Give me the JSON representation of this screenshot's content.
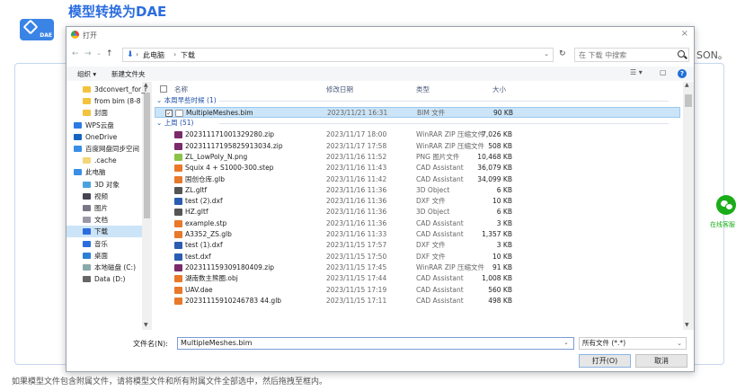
{
  "page": {
    "title": "模型转换为DAE",
    "logo_tag": "DAE",
    "json_suffix": "SON。",
    "footer_text": "如果模型文件包含附属文件，请将模型文件和所有附属文件全部选中，然后拖拽至框内。",
    "wechat_label": "在线客服"
  },
  "dialog": {
    "title": "打开",
    "close_symbol": "×",
    "nav": {
      "back": "←",
      "forward": "→",
      "recent": "⌄",
      "up": "↑"
    },
    "breadcrumb": [
      "此电脑",
      "下载"
    ],
    "breadcrumb_sep": "›",
    "path_dropdown": "⌄",
    "refresh": "↻",
    "search_placeholder": "在 下载 中搜索",
    "toolbar": {
      "organize": "组织 ▾",
      "new_folder": "新建文件夹",
      "view": "☰ ▾",
      "pane": "▢",
      "help": "?"
    },
    "sidebar": [
      {
        "label": "3dconvert_for_r",
        "color": "#f3c33d"
      },
      {
        "label": "from bim  (8-8",
        "color": "#f3c33d"
      },
      {
        "label": "封面",
        "color": "#f3c33d"
      },
      {
        "label": "WPS云盘",
        "color": "#2c7be5"
      },
      {
        "label": "OneDrive",
        "color": "#1565c0"
      },
      {
        "label": "百度网盘同步空间",
        "color": "#3a8ee6"
      },
      {
        "label": ".cache",
        "color": "#f3d57a"
      },
      {
        "label": "此电脑",
        "color": "#3a8ee6"
      },
      {
        "label": "3D 对象",
        "color": "#4aa3df"
      },
      {
        "label": "视频",
        "color": "#445"
      },
      {
        "label": "图片",
        "color": "#778"
      },
      {
        "label": "文档",
        "color": "#99a"
      },
      {
        "label": "下载",
        "color": "#2b6de0"
      },
      {
        "label": "音乐",
        "color": "#2b6de0"
      },
      {
        "label": "桌面",
        "color": "#2b7fd6"
      },
      {
        "label": "本地磁盘 (C:)",
        "color": "#8aa"
      },
      {
        "label": "Data (D:)",
        "color": "#666"
      }
    ],
    "columns": {
      "name": "名称",
      "date": "修改日期",
      "type": "类型",
      "size": "大小"
    },
    "groups": [
      {
        "label": "本周早些时候 (1)",
        "files": [
          {
            "name": "MultipleMeshes.bim",
            "date": "2023/11/21 16:31",
            "type": "BIM 文件",
            "size": "90 KB",
            "icon": "#ffffff",
            "selected": true
          }
        ]
      },
      {
        "label": "上周 (51)",
        "files": [
          {
            "name": "202311171001329280.zip",
            "date": "2023/11/17 18:00",
            "type": "WinRAR ZIP 压缩文件",
            "size": "7,026 KB",
            "icon": "#7b2a6b"
          },
          {
            "name": "202311171958259130​34.zip",
            "date": "2023/11/17 17:58",
            "type": "WinRAR ZIP 压缩文件",
            "size": "508 KB",
            "icon": "#7b2a6b"
          },
          {
            "name": "ZL_LowPoly_N.png",
            "date": "2023/11/16 11:52",
            "type": "PNG 图片文件",
            "size": "10,468 KB",
            "icon": "#8bc34a"
          },
          {
            "name": "Squix 4 + S1000-300.step",
            "date": "2023/11/16 11:43",
            "type": "CAD Assistant",
            "size": "36,079 KB",
            "icon": "#e8782a"
          },
          {
            "name": "国创仓库.glb",
            "date": "2023/11/16 11:42",
            "type": "CAD Assistant",
            "size": "34,099 KB",
            "icon": "#e8782a"
          },
          {
            "name": "ZL.gltf",
            "date": "2023/11/16 11:36",
            "type": "3D Object",
            "size": "6 KB",
            "icon": "#555555"
          },
          {
            "name": "test (2).dxf",
            "date": "2023/11/16 11:36",
            "type": "DXF 文件",
            "size": "10 KB",
            "icon": "#2a5db0"
          },
          {
            "name": "HZ.gltf",
            "date": "2023/11/16 11:36",
            "type": "3D Object",
            "size": "6 KB",
            "icon": "#555555"
          },
          {
            "name": "example.stp",
            "date": "2023/11/16 11:36",
            "type": "CAD Assistant",
            "size": "3 KB",
            "icon": "#e8782a"
          },
          {
            "name": "A3352_ZS.glb",
            "date": "2023/11/16 11:33",
            "type": "CAD Assistant",
            "size": "1,357 KB",
            "icon": "#e8782a"
          },
          {
            "name": "test (1).dxf",
            "date": "2023/11/15 17:57",
            "type": "DXF 文件",
            "size": "3 KB",
            "icon": "#2a5db0"
          },
          {
            "name": "test.dxf",
            "date": "2023/11/15 17:50",
            "type": "DXF 文件",
            "size": "10 KB",
            "icon": "#2a5db0"
          },
          {
            "name": "202311159309180409.zip",
            "date": "2023/11/15 17:45",
            "type": "WinRAR ZIP 压缩文件",
            "size": "91 KB",
            "icon": "#7b2a6b"
          },
          {
            "name": "湖南数主熊圈.obj",
            "date": "2023/11/15 17:44",
            "type": "CAD Assistant",
            "size": "1,008 KB",
            "icon": "#e8782a"
          },
          {
            "name": "UAV.dae",
            "date": "2023/11/15 17:19",
            "type": "CAD Assistant",
            "size": "560 KB",
            "icon": "#e8782a"
          },
          {
            "name": "20231115910246783 44.glb",
            "date": "2023/11/15 17:11",
            "type": "CAD Assistant",
            "size": "498 KB",
            "icon": "#e8782a"
          }
        ]
      }
    ],
    "filename_label": "文件名(N):",
    "filename_value": "MultipleMeshes.bim",
    "filetype_value": "所有文件 (*.*)",
    "open_button": "打开(O)",
    "cancel_button": "取消"
  }
}
